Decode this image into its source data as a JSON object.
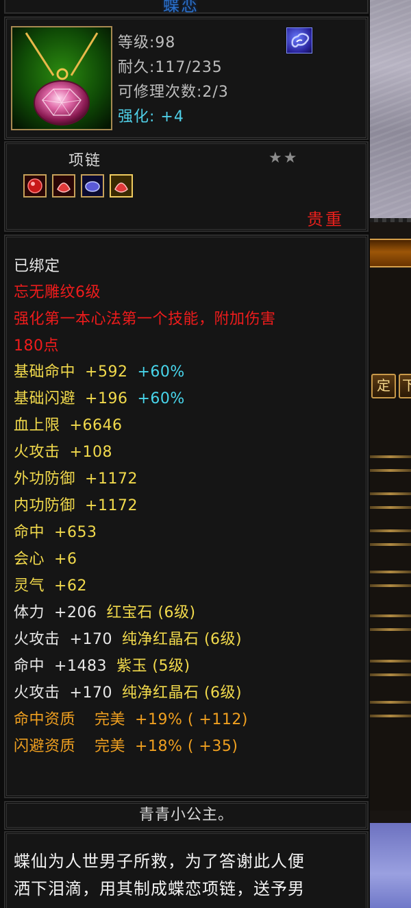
{
  "window": {
    "title_fragment": "蝶恋"
  },
  "item": {
    "level": "等级:98",
    "durability": "耐久:117/235",
    "repairs": "可修理次数:2/3",
    "enhance_label": "强化: ",
    "enhance_value": "+4",
    "type": "项链",
    "stars": "★★",
    "rarity": "贵重",
    "icon": "pendant-icon",
    "school_icon": "cloud-school-icon"
  },
  "attributes": {
    "bound": "已绑定",
    "engraving": "忘无雕纹6级",
    "skill_line1": "强化第一本心法第一个技能，附加伤害",
    "skill_line2": "180点",
    "lines": [
      {
        "name": "基础命中",
        "value": "+592",
        "extra": "+60%"
      },
      {
        "name": "基础闪避",
        "value": "+196",
        "extra": "+60%"
      },
      {
        "name": "血上限",
        "value": "+6646"
      },
      {
        "name": "火攻击",
        "value": "+108"
      },
      {
        "name": "外功防御",
        "value": "+1172"
      },
      {
        "name": "内功防御",
        "value": "+1172"
      },
      {
        "name": "命中",
        "value": "+653"
      },
      {
        "name": "会心",
        "value": "+6"
      },
      {
        "name": "灵气",
        "value": "+62"
      }
    ],
    "gems": [
      {
        "name": "体力",
        "value": "+206",
        "gem": "红宝石 (6级)"
      },
      {
        "name": "火攻击",
        "value": "+170",
        "gem": "纯净红晶石 (6级)"
      },
      {
        "name": "命中",
        "value": "+1483",
        "gem": "紫玉 (5级)"
      },
      {
        "name": "火攻击",
        "value": "+170",
        "gem": "纯净红晶石 (6级)"
      }
    ],
    "qualities": [
      {
        "name": "命中资质",
        "grade": "完美",
        "value": "+19% ( +112)"
      },
      {
        "name": "闪避资质",
        "grade": "完美",
        "value": "+18% ( +35)"
      }
    ]
  },
  "owner": "青青小公主。",
  "description": {
    "line1": "蝶仙为人世男子所救，为了答谢此人便",
    "line2": "洒下泪滴，用其制成蝶恋项链，送予男"
  },
  "background": {
    "button_1": "定",
    "button_2": "下"
  },
  "colors": {
    "white": "#e8e8e8",
    "red": "#ee1c1c",
    "yellow": "#f2da4c",
    "orange": "#f0a020",
    "cyan": "#48d6ec",
    "frame_gold": "#a88a52"
  }
}
